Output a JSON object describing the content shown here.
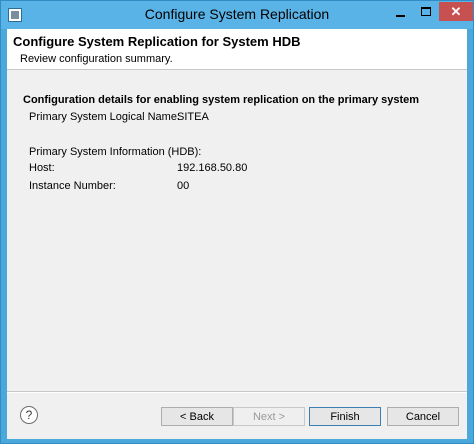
{
  "window": {
    "title": "Configure System Replication",
    "close_glyph": "✕"
  },
  "header": {
    "title": "Configure System Replication for System HDB",
    "description": "Review configuration summary."
  },
  "summary": {
    "section_title": "Configuration details for enabling system replication on the primary system",
    "logical_name_label": "Primary System Logical Name:",
    "logical_name_value": "SITEA",
    "info_label": "Primary System Information (HDB):",
    "host_label": "Host:",
    "host_value": "192.168.50.80",
    "instance_label": "Instance Number:",
    "instance_value": "00"
  },
  "footer": {
    "help_glyph": "?",
    "back_label": "< Back",
    "next_label": "Next >",
    "finish_label": "Finish",
    "cancel_label": "Cancel"
  }
}
